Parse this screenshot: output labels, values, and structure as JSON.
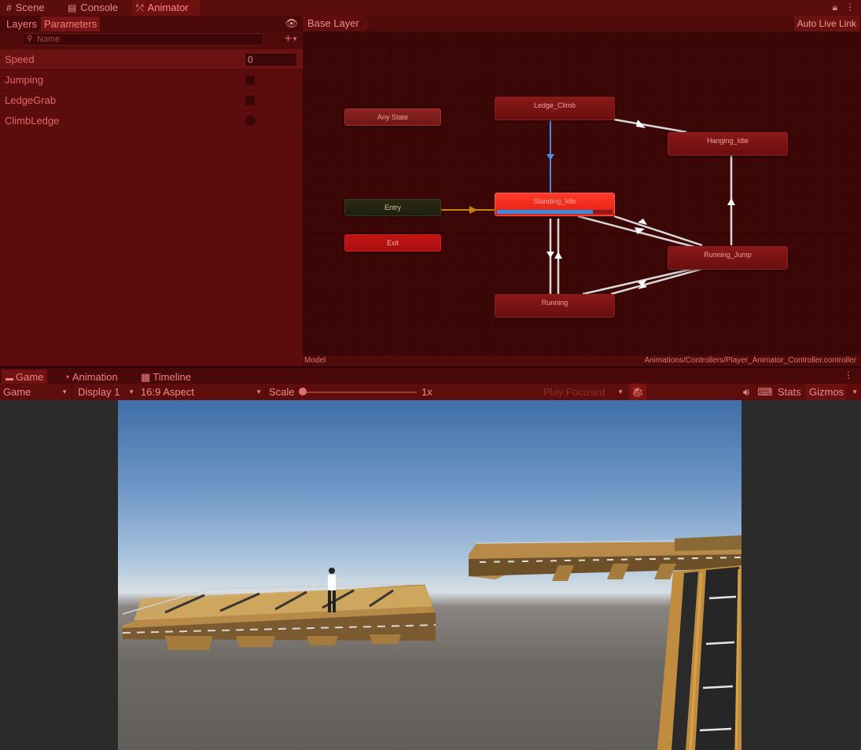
{
  "top_tabs": [
    {
      "icon": "#",
      "label": "Scene"
    },
    {
      "icon": "▤",
      "label": "Console"
    },
    {
      "icon": "⤱",
      "label": "Animator"
    }
  ],
  "animator": {
    "left_tabs": {
      "layers": "Layers",
      "parameters": "Parameters"
    },
    "search_placeholder": "Name",
    "parameters": [
      {
        "name": "Speed",
        "type": "float",
        "value": "0"
      },
      {
        "name": "Jumping",
        "type": "bool",
        "value": false
      },
      {
        "name": "LedgeGrab",
        "type": "bool",
        "value": false
      },
      {
        "name": "ClimbLedge",
        "type": "trigger",
        "value": false
      }
    ],
    "breadcrumb": "Base Layer",
    "auto_live_link": "Auto Live Link",
    "states": {
      "any_state": "Any State",
      "entry": "Entry",
      "exit": "Exit",
      "ledge_climb": "Ledge_Climb",
      "hanging_idle": "Hanging_Idle",
      "standing_idle": "Standing_Idle",
      "running_jump": "Running_Jump",
      "running": "Running"
    },
    "current_state_progress": 0.83,
    "footer_left": "Model",
    "footer_right": "Animations/Controllers/Player_Animator_Controller.controller"
  },
  "bottom_tabs": [
    {
      "icon": "🎮",
      "label": "Game"
    },
    {
      "icon": "◔",
      "label": "Animation"
    },
    {
      "icon": "▦",
      "label": "Timeline"
    }
  ],
  "game_toolbar": {
    "view": "Game",
    "display": "Display 1",
    "aspect": "16:9 Aspect",
    "scale_label": "Scale",
    "scale_value": "1x",
    "play_mode": "Play Focused",
    "stats": "Stats",
    "gizmos": "Gizmos"
  },
  "colors": {
    "accent": "#e02010",
    "progress": "#3a8be0",
    "transition": "#d0d0d0",
    "entry_transition": "#c8820a"
  }
}
